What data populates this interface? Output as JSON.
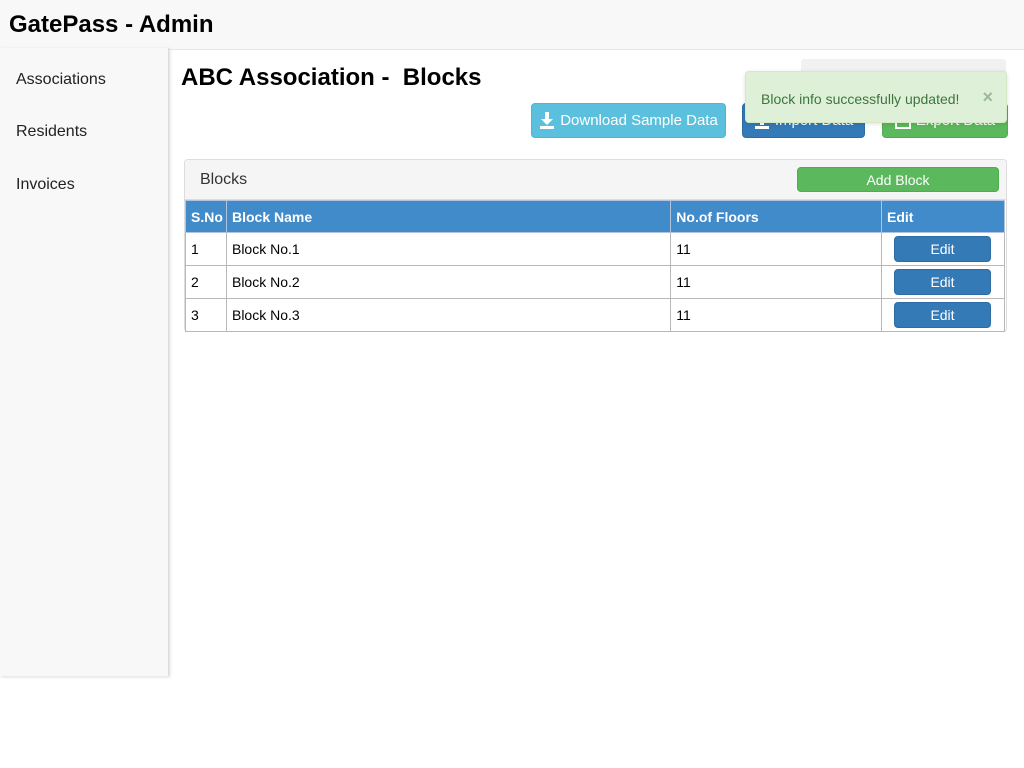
{
  "app": {
    "title": "GatePass - Admin"
  },
  "sidebar": {
    "items": [
      {
        "label": "Associations"
      },
      {
        "label": "Residents"
      },
      {
        "label": "Invoices"
      }
    ]
  },
  "page": {
    "title": "ABC Association -  Blocks"
  },
  "toolbar": {
    "download_label": "Download Sample Data",
    "import_label": "Import Data",
    "export_label": "Export Data"
  },
  "alert": {
    "message": "Block info successfully updated!",
    "close": "×"
  },
  "panel": {
    "title": "Blocks",
    "add_label": "Add Block"
  },
  "table": {
    "headers": [
      "S.No",
      "Block Name",
      "No.of Floors",
      "Edit"
    ],
    "rows": [
      {
        "sno": "1",
        "name": "Block No.1",
        "floors": "11",
        "edit": "Edit"
      },
      {
        "sno": "2",
        "name": "Block No.2",
        "floors": "11",
        "edit": "Edit"
      },
      {
        "sno": "3",
        "name": "Block No.3",
        "floors": "11",
        "edit": "Edit"
      }
    ]
  },
  "colors": {
    "info": "#5bc0de",
    "primary": "#337ab7",
    "success": "#5cb85c",
    "table_header": "#428bca",
    "alert_bg": "#dff0d8",
    "alert_text": "#3c763d"
  }
}
